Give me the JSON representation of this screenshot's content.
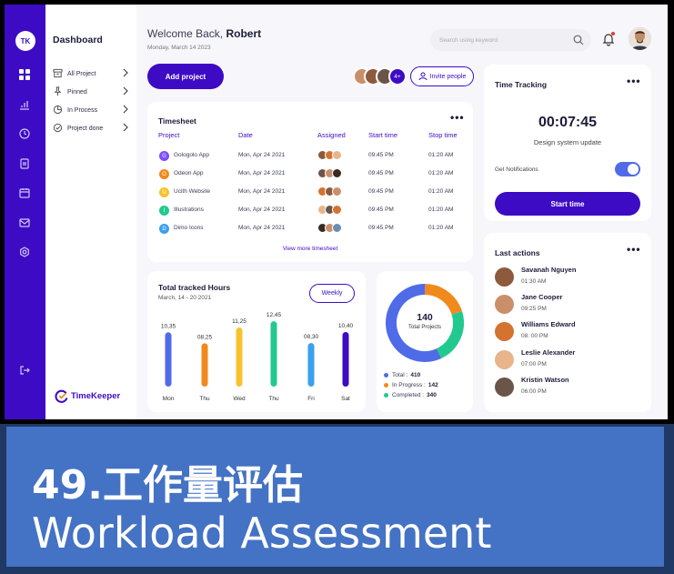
{
  "colors": {
    "accent": "#3e0bc4",
    "green": "#22c98e",
    "orange": "#f08a1c",
    "yellow": "#f6c32e",
    "blue": "#4f6be8",
    "banner": "#4472c4"
  },
  "sidebar": {
    "avatar_initials": "TK",
    "icons": [
      "grid-icon",
      "chart-icon",
      "clock-icon",
      "document-icon",
      "calendar-icon",
      "mail-icon",
      "settings-icon",
      "logout-icon"
    ]
  },
  "nav": {
    "title": "Dashboard",
    "items": [
      {
        "label": "All Project",
        "icon": "archive-icon"
      },
      {
        "label": "Pinned",
        "icon": "pin-icon"
      },
      {
        "label": "In Process",
        "icon": "progress-icon"
      },
      {
        "label": "Project done",
        "icon": "check-circle-icon"
      }
    ],
    "brand": "TimeKeeper"
  },
  "header": {
    "welcome_prefix": "Welcome Back,",
    "user_name": "Robert",
    "date": "Monday, March 14 2023",
    "search_placeholder": "Search using keyword"
  },
  "actions": {
    "add_project": "Add project",
    "team_more": "4+",
    "invite": "Invite people"
  },
  "timesheet": {
    "title": "Timesheet",
    "columns": [
      "Project",
      "Date",
      "Assigned",
      "Start time",
      "Stop time"
    ],
    "rows": [
      {
        "letter": "G",
        "color": "#7c4dff",
        "project": "Gologolo App",
        "date": "Mon, Apr 24 2021",
        "start": "09:45 PM",
        "stop": "01:20 AM"
      },
      {
        "letter": "O",
        "color": "#f08a1c",
        "project": "Odeon App",
        "date": "Mon, Apr 24 2021",
        "start": "09:45 PM",
        "stop": "01:20 AM"
      },
      {
        "letter": "U",
        "color": "#f6c32e",
        "project": "Ucith Website",
        "date": "Mon, Apr 24 2021",
        "start": "09:45 PM",
        "stop": "01:20 AM"
      },
      {
        "letter": "I",
        "color": "#22c98e",
        "project": "Illustrations",
        "date": "Mon, Apr 24 2021",
        "start": "09:45 PM",
        "stop": "01:20 AM"
      },
      {
        "letter": "D",
        "color": "#3aa0f0",
        "project": "Dimo Icons",
        "date": "Mon, Apr 24 2021",
        "start": "09:45 PM",
        "stop": "01:20 AM"
      }
    ],
    "more": "View more timesheet"
  },
  "tracked": {
    "title": "Total tracked Hours",
    "range": "March, 14 - 20 2021",
    "period": "Weekly"
  },
  "chart_data": {
    "type": "bar",
    "title": "Total tracked Hours",
    "categories": [
      "Mon",
      "Thu",
      "Wed",
      "Thu",
      "Fri",
      "Sat"
    ],
    "value_labels": [
      "10,35",
      "08,25",
      "11,25",
      "12,45",
      "08,30",
      "10,40"
    ],
    "values": [
      10.35,
      8.25,
      11.25,
      12.45,
      8.3,
      10.4
    ],
    "colors": [
      "#4f6be8",
      "#f08a1c",
      "#f6c32e",
      "#22c98e",
      "#3aa0f0",
      "#3e0bc4"
    ],
    "ylim": [
      0,
      13
    ]
  },
  "projects_donut": {
    "total": "140",
    "label": "Total Projects",
    "legend": [
      {
        "label": "Total :",
        "value": "410",
        "color": "#4f6be8"
      },
      {
        "label": "In Progress :",
        "value": "142",
        "color": "#f08a1c"
      },
      {
        "label": "Completed :",
        "value": "340",
        "color": "#22c98e"
      }
    ],
    "segments": [
      {
        "name": "Total",
        "fraction": 0.57,
        "color": "#4f6be8"
      },
      {
        "name": "In Progress",
        "fraction": 0.2,
        "color": "#f08a1c"
      },
      {
        "name": "Completed",
        "fraction": 0.23,
        "color": "#22c98e"
      }
    ]
  },
  "time_tracking": {
    "title": "Time Tracking",
    "time": "00:07:45",
    "task": "Design system update",
    "notifications_label": "Get Notifications",
    "notifications_on": true,
    "start_label": "Start time"
  },
  "last_actions": {
    "title": "Last actions",
    "items": [
      {
        "name": "Savanah Nguyen",
        "time": "01:30 AM",
        "color": "#8d5a3b"
      },
      {
        "name": "Jane Cooper",
        "time": "09:25 PM",
        "color": "#c98f6b"
      },
      {
        "name": "Williams Edward",
        "time": "08: 00 PM",
        "color": "#d4722f"
      },
      {
        "name": "Leslie Alexander",
        "time": "07:00 PM",
        "color": "#e7b48c"
      },
      {
        "name": "Kristin Watson",
        "time": "06:00 PM",
        "color": "#6b5548"
      }
    ]
  },
  "banner": {
    "zh": "49.工作量评估",
    "en": "Workload Assessment"
  }
}
